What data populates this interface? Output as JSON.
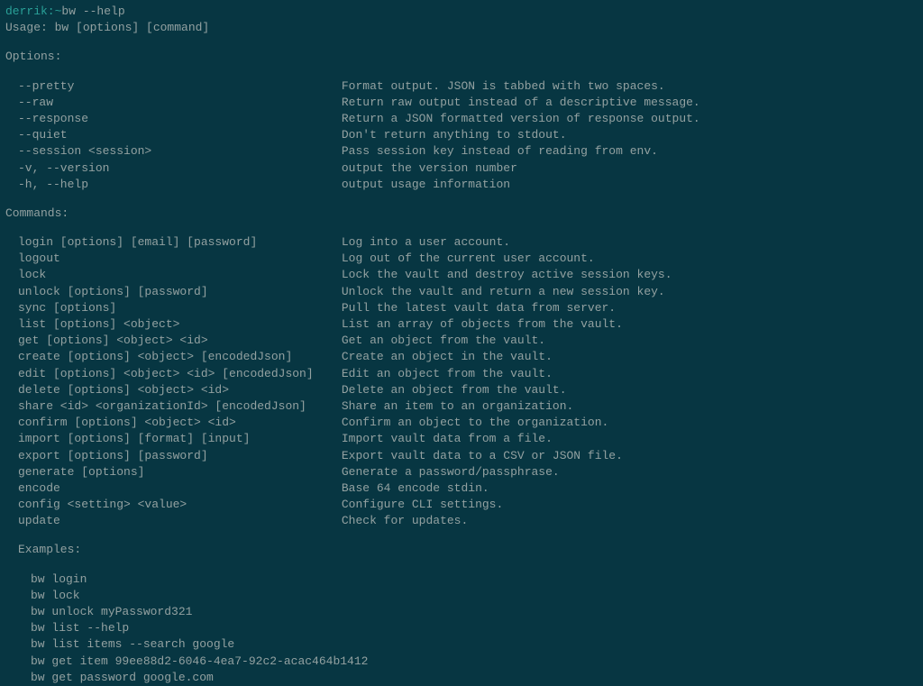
{
  "prompt": {
    "user": "derrik:~ ",
    "command": "bw --help"
  },
  "usage": "Usage: bw [options] [command]",
  "sections": {
    "options_header": "Options:",
    "commands_header": "Commands:",
    "examples_header": "Examples:"
  },
  "options": [
    {
      "flag": "--pretty",
      "desc": "Format output. JSON is tabbed with two spaces."
    },
    {
      "flag": "--raw",
      "desc": "Return raw output instead of a descriptive message."
    },
    {
      "flag": "--response",
      "desc": "Return a JSON formatted version of response output."
    },
    {
      "flag": "--quiet",
      "desc": "Don't return anything to stdout."
    },
    {
      "flag": "--session <session>",
      "desc": "Pass session key instead of reading from env."
    },
    {
      "flag": "-v, --version",
      "desc": "output the version number"
    },
    {
      "flag": "-h, --help",
      "desc": "output usage information"
    }
  ],
  "commands": [
    {
      "name": "login [options] [email] [password]",
      "desc": "Log into a user account."
    },
    {
      "name": "logout",
      "desc": "Log out of the current user account."
    },
    {
      "name": "lock",
      "desc": "Lock the vault and destroy active session keys."
    },
    {
      "name": "unlock [options] [password]",
      "desc": "Unlock the vault and return a new session key."
    },
    {
      "name": "sync [options]",
      "desc": "Pull the latest vault data from server."
    },
    {
      "name": "list [options] <object>",
      "desc": "List an array of objects from the vault."
    },
    {
      "name": "get [options] <object> <id>",
      "desc": "Get an object from the vault."
    },
    {
      "name": "create [options] <object> [encodedJson]",
      "desc": "Create an object in the vault."
    },
    {
      "name": "edit [options] <object> <id> [encodedJson]",
      "desc": "Edit an object from the vault."
    },
    {
      "name": "delete [options] <object> <id>",
      "desc": "Delete an object from the vault."
    },
    {
      "name": "share <id> <organizationId> [encodedJson]",
      "desc": "Share an item to an organization."
    },
    {
      "name": "confirm [options] <object> <id>",
      "desc": "Confirm an object to the organization."
    },
    {
      "name": "import [options] [format] [input]",
      "desc": "Import vault data from a file."
    },
    {
      "name": "export [options] [password]",
      "desc": "Export vault data to a CSV or JSON file."
    },
    {
      "name": "generate [options]",
      "desc": "Generate a password/passphrase."
    },
    {
      "name": "encode",
      "desc": "Base 64 encode stdin."
    },
    {
      "name": "config <setting> <value>",
      "desc": "Configure CLI settings."
    },
    {
      "name": "update",
      "desc": "Check for updates."
    }
  ],
  "examples": [
    "bw login",
    "bw lock",
    "bw unlock myPassword321",
    "bw list --help",
    "bw list items --search google",
    "bw get item 99ee88d2-6046-4ea7-92c2-acac464b1412",
    "bw get password google.com"
  ]
}
